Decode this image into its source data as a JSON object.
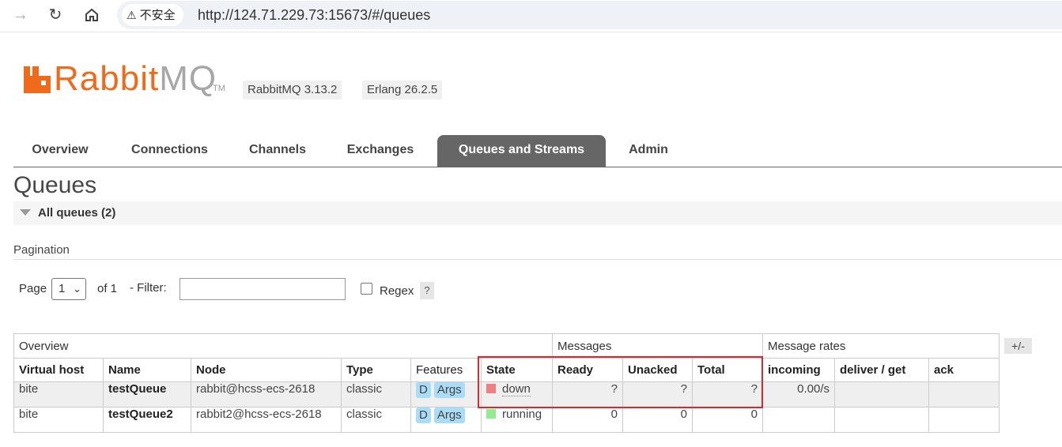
{
  "browser": {
    "security_label": "不安全",
    "url": "http://124.71.229.73:15673/#/queues"
  },
  "logo": {
    "rabbit": "Rabbit",
    "mq": "MQ",
    "tm": "TM"
  },
  "versions": {
    "rabbitmq": "RabbitMQ 3.13.2",
    "erlang": "Erlang 26.2.5"
  },
  "tabs": [
    "Overview",
    "Connections",
    "Channels",
    "Exchanges",
    "Queues and Streams",
    "Admin"
  ],
  "active_tab": "Queues and Streams",
  "page_title": "Queues",
  "section": "All queues (2)",
  "pagination": {
    "heading": "Pagination",
    "page_label": "Page",
    "page_value": "1",
    "of_label": "of 1",
    "filter_label": "- Filter:",
    "filter_value": "",
    "regex_label": "Regex",
    "help": "?"
  },
  "table": {
    "groups": [
      "Overview",
      "Messages",
      "Message rates"
    ],
    "plus_minus": "+/-",
    "columns": [
      "Virtual host",
      "Name",
      "Node",
      "Type",
      "Features",
      "State",
      "Ready",
      "Unacked",
      "Total",
      "incoming",
      "deliver / get",
      "ack"
    ],
    "rows": [
      {
        "vhost": "bite",
        "name": "testQueue",
        "node": "rabbit@hcss-ecs-2618",
        "type": "classic",
        "features": [
          "D",
          "Args"
        ],
        "state": "down",
        "ready": "?",
        "unacked": "?",
        "total": "?",
        "incoming": "0.00/s",
        "deliver_get": "",
        "ack": ""
      },
      {
        "vhost": "bite",
        "name": "testQueue2",
        "node": "rabbit2@hcss-ecs-2618",
        "type": "classic",
        "features": [
          "D",
          "Args"
        ],
        "state": "running",
        "ready": "0",
        "unacked": "0",
        "total": "0",
        "incoming": "",
        "deliver_get": "",
        "ack": ""
      }
    ]
  },
  "colors": {
    "brand_orange": "#f06a1c",
    "state_down": "#f08080",
    "state_running": "#90ee90",
    "highlight": "#e0262b"
  }
}
